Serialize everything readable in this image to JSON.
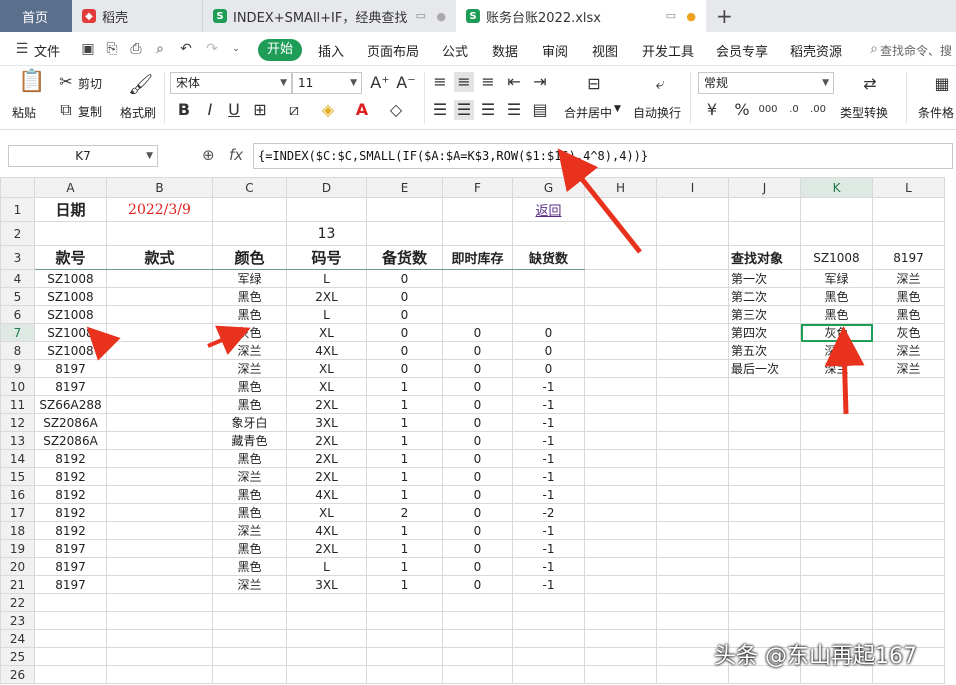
{
  "tabs": [
    {
      "label": "首页"
    },
    {
      "label": "稻壳"
    },
    {
      "label": "INDEX+SMAll+IF，经典查找"
    },
    {
      "label": "账务台账2022.xlsx"
    }
  ],
  "menu": {
    "file": "文件",
    "start": "开始",
    "items": [
      "插入",
      "页面布局",
      "公式",
      "数据",
      "审阅",
      "视图",
      "开发工具",
      "会员专享",
      "稻壳资源"
    ],
    "search": "查找命令、搜"
  },
  "ribbon": {
    "paste": "粘贴",
    "cut": "剪切",
    "copy": "复制",
    "format_painter": "格式刷",
    "font_name": "宋体",
    "font_size": "11",
    "merge_center": "合并居中",
    "wrap": "自动换行",
    "number_format": "常规",
    "type_convert": "类型转换",
    "cond_format": "条件格"
  },
  "formula_bar": {
    "cell_ref": "K7",
    "formula": "{=INDEX($C:$C,SMALL(IF($A:$A=K$3,ROW($1:$16),4^8),4))}"
  },
  "columns": [
    "A",
    "B",
    "C",
    "D",
    "E",
    "F",
    "G",
    "H",
    "I",
    "J",
    "K",
    "L"
  ],
  "rows": [
    [
      "日期",
      "2022/3/9",
      "",
      "",
      "",
      "",
      "返回",
      "",
      "",
      "",
      "",
      ""
    ],
    [
      "",
      "",
      "",
      "13",
      "",
      "",
      "",
      "",
      "",
      "",
      "",
      ""
    ],
    [
      "款号",
      "款式",
      "颜色",
      "码号",
      "备货数",
      "即时库存",
      "缺货数",
      "",
      "",
      "查找对象",
      "SZ1008",
      "8197"
    ],
    [
      "SZ1008",
      "",
      "军绿",
      "L",
      "0",
      "",
      "",
      "",
      "",
      "第一次",
      "军绿",
      "深兰"
    ],
    [
      "SZ1008",
      "",
      "黑色",
      "2XL",
      "0",
      "",
      "",
      "",
      "",
      "第二次",
      "黑色",
      "黑色"
    ],
    [
      "SZ1008",
      "",
      "黑色",
      "L",
      "0",
      "",
      "",
      "",
      "",
      "第三次",
      "黑色",
      "黑色"
    ],
    [
      "SZ1008",
      "",
      "灰色",
      "XL",
      "0",
      "0",
      "0",
      "",
      "",
      "第四次",
      "灰色",
      "灰色"
    ],
    [
      "SZ1008",
      "",
      "深兰",
      "4XL",
      "0",
      "0",
      "0",
      "",
      "",
      "第五次",
      "深兰",
      "深兰"
    ],
    [
      "8197",
      "",
      "深兰",
      "XL",
      "0",
      "0",
      "0",
      "",
      "",
      "最后一次",
      "深兰",
      "深兰"
    ],
    [
      "8197",
      "",
      "黑色",
      "XL",
      "1",
      "0",
      "-1",
      "",
      "",
      "",
      "",
      ""
    ],
    [
      "SZ66A288",
      "",
      "黑色",
      "2XL",
      "1",
      "0",
      "-1",
      "",
      "",
      "",
      "",
      ""
    ],
    [
      "SZ2086A",
      "",
      "象牙白",
      "3XL",
      "1",
      "0",
      "-1",
      "",
      "",
      "",
      "",
      ""
    ],
    [
      "SZ2086A",
      "",
      "藏青色",
      "2XL",
      "1",
      "0",
      "-1",
      "",
      "",
      "",
      "",
      ""
    ],
    [
      "8192",
      "",
      "黑色",
      "2XL",
      "1",
      "0",
      "-1",
      "",
      "",
      "",
      "",
      ""
    ],
    [
      "8192",
      "",
      "深兰",
      "2XL",
      "1",
      "0",
      "-1",
      "",
      "",
      "",
      "",
      ""
    ],
    [
      "8192",
      "",
      "黑色",
      "4XL",
      "1",
      "0",
      "-1",
      "",
      "",
      "",
      "",
      ""
    ],
    [
      "8192",
      "",
      "黑色",
      "XL",
      "2",
      "0",
      "-2",
      "",
      "",
      "",
      "",
      ""
    ],
    [
      "8192",
      "",
      "深兰",
      "4XL",
      "1",
      "0",
      "-1",
      "",
      "",
      "",
      "",
      ""
    ],
    [
      "8197",
      "",
      "黑色",
      "2XL",
      "1",
      "0",
      "-1",
      "",
      "",
      "",
      "",
      ""
    ],
    [
      "8197",
      "",
      "黑色",
      "L",
      "1",
      "0",
      "-1",
      "",
      "",
      "",
      "",
      ""
    ],
    [
      "8197",
      "",
      "深兰",
      "3XL",
      "1",
      "0",
      "-1",
      "",
      "",
      "",
      "",
      ""
    ],
    [
      "",
      "",
      "",
      "",
      "",
      "",
      "",
      "",
      "",
      "",
      "",
      ""
    ],
    [
      "",
      "",
      "",
      "",
      "",
      "",
      "",
      "",
      "",
      "",
      "",
      ""
    ],
    [
      "",
      "",
      "",
      "",
      "",
      "",
      "",
      "",
      "",
      "",
      "",
      ""
    ],
    [
      "",
      "",
      "",
      "",
      "",
      "",
      "",
      "",
      "",
      "",
      "",
      ""
    ],
    [
      "",
      "",
      "",
      "",
      "",
      "",
      "",
      "",
      "",
      "",
      "",
      ""
    ]
  ],
  "watermark": "头条 @东山再起167",
  "colors": {
    "accent": "#1e9d57",
    "red_text": "#e02020",
    "arrow": "#e8321e",
    "link": "#5b2a86"
  }
}
